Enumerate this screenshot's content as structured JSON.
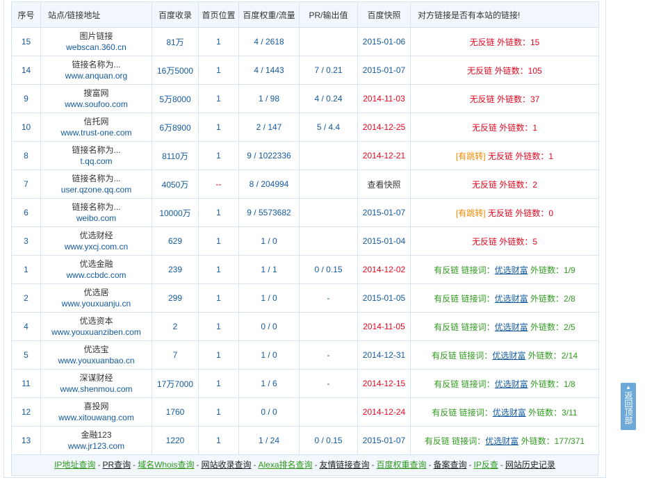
{
  "headers": {
    "seq": "序号",
    "site": "站点/链接地址",
    "baidu_index": "百度收录",
    "home_pos": "首页位置",
    "weight": "百度权重/流量",
    "pr": "PR/输出值",
    "snapshot": "百度快照",
    "status": "对方链接是否有本站的链接!"
  },
  "rows": [
    {
      "seq": "15",
      "name": "图片链接",
      "domain": "webscan.360.cn",
      "index": "81万",
      "pos": "1",
      "weight": "4 / 2618",
      "pr": "",
      "date": "2015-01-06",
      "date_color": "blue",
      "jump": "",
      "back": "无反链",
      "kw_label": "",
      "kw": "",
      "out_label": "外链数：",
      "out": "15",
      "ok": false
    },
    {
      "seq": "14",
      "name": "链接名称为...",
      "domain": "www.anquan.org",
      "index": "16万5000",
      "pos": "1",
      "weight": "4 / 1443",
      "pr": "7 / 0.21",
      "date": "2015-01-07",
      "date_color": "blue",
      "jump": "",
      "back": "无反链",
      "kw_label": "",
      "kw": "",
      "out_label": "外链数：",
      "out": "105",
      "ok": false
    },
    {
      "seq": "9",
      "name": "搜富网",
      "domain": "www.soufoo.com",
      "index": "5万8000",
      "pos": "1",
      "weight": "1 / 98",
      "pr": "4 / 0.24",
      "date": "2014-11-03",
      "date_color": "red",
      "jump": "",
      "back": "无反链",
      "kw_label": "",
      "kw": "",
      "out_label": "外链数：",
      "out": "37",
      "ok": false
    },
    {
      "seq": "10",
      "name": "信托网",
      "domain": "www.trust-one.com",
      "index": "6万8900",
      "pos": "1",
      "weight": "2 / 147",
      "pr": "5 / 4.4",
      "date": "2014-12-25",
      "date_color": "red",
      "jump": "",
      "back": "无反链",
      "kw_label": "",
      "kw": "",
      "out_label": "外链数：",
      "out": "1",
      "ok": false
    },
    {
      "seq": "8",
      "name": "链接名称为...",
      "domain": "t.qq.com",
      "index": "8110万",
      "pos": "1",
      "weight": "9 / 1022336",
      "pr": "",
      "date": "2014-12-21",
      "date_color": "red",
      "jump": "[有跳转]",
      "back": "无反链",
      "kw_label": "",
      "kw": "",
      "out_label": "外链数：",
      "out": "1",
      "ok": false
    },
    {
      "seq": "7",
      "name": "链接名称为...",
      "domain": "user.qzone.qq.com",
      "index": "4050万",
      "pos": "--",
      "weight": "8 / 204994",
      "pr": "",
      "date": "查看快照",
      "date_color": "dark",
      "jump": "",
      "back": "无反链",
      "kw_label": "",
      "kw": "",
      "out_label": "外链数：",
      "out": "2",
      "ok": false
    },
    {
      "seq": "6",
      "name": "链接名称为...",
      "domain": "weibo.com",
      "index": "10000万",
      "pos": "1",
      "weight": "9 / 5573682",
      "pr": "",
      "date": "2015-01-07",
      "date_color": "blue",
      "jump": "[有跳转]",
      "back": "无反链",
      "kw_label": "",
      "kw": "",
      "out_label": "外链数：",
      "out": "0",
      "ok": false
    },
    {
      "seq": "3",
      "name": "优选财经",
      "domain": "www.yxcj.com.cn",
      "index": "629",
      "pos": "1",
      "weight": "1 / 0",
      "pr": "",
      "date": "2015-01-04",
      "date_color": "blue",
      "jump": "",
      "back": "无反链",
      "kw_label": "",
      "kw": "",
      "out_label": "外链数：",
      "out": "5",
      "ok": false
    },
    {
      "seq": "1",
      "name": "优选金融",
      "domain": "www.ccbdc.com",
      "index": "239",
      "pos": "1",
      "weight": "1 / 1",
      "pr": "0 / 0.15",
      "date": "2014-12-02",
      "date_color": "red",
      "jump": "",
      "back": "有反链",
      "kw_label": "链接词：",
      "kw": "优选财富",
      "out_label": "外链数：",
      "out": "1/9",
      "ok": true
    },
    {
      "seq": "2",
      "name": "优选居",
      "domain": "www.youxuanju.cn",
      "index": "299",
      "pos": "1",
      "weight": "1 / 0",
      "pr": "-",
      "date": "2015-01-05",
      "date_color": "blue",
      "jump": "",
      "back": "有反链",
      "kw_label": "链接词：",
      "kw": "优选财富",
      "out_label": "外链数：",
      "out": "2/8",
      "ok": true
    },
    {
      "seq": "4",
      "name": "优选资本",
      "domain": "www.youxuanziben.com",
      "index": "2",
      "pos": "1",
      "weight": "0 / 0",
      "pr": "",
      "date": "2014-11-05",
      "date_color": "red",
      "jump": "",
      "back": "有反链",
      "kw_label": "链接词：",
      "kw": "优选财富",
      "out_label": "外链数：",
      "out": "2/5",
      "ok": true
    },
    {
      "seq": "5",
      "name": "优选宝",
      "domain": "www.youxuanbao.cn",
      "index": "7",
      "pos": "1",
      "weight": "1 / 0",
      "pr": "-",
      "date": "2014-12-31",
      "date_color": "blue",
      "jump": "",
      "back": "有反链",
      "kw_label": "链接词：",
      "kw": "优选财富",
      "out_label": "外链数：",
      "out": "2/14",
      "ok": true
    },
    {
      "seq": "11",
      "name": "深谋财经",
      "domain": "www.shenmou.com",
      "index": "17万7000",
      "pos": "1",
      "weight": "1 / 6",
      "pr": "-",
      "date": "2014-12-15",
      "date_color": "red",
      "jump": "",
      "back": "有反链",
      "kw_label": "链接词：",
      "kw": "优选财富",
      "out_label": "外链数：",
      "out": "1/8",
      "ok": true
    },
    {
      "seq": "12",
      "name": "喜投网",
      "domain": "www.xitouwang.com",
      "index": "1760",
      "pos": "1",
      "weight": "0 / 0",
      "pr": "",
      "date": "2014-12-24",
      "date_color": "red",
      "jump": "",
      "back": "有反链",
      "kw_label": "链接词：",
      "kw": "优选财富",
      "out_label": "外链数：",
      "out": "3/11",
      "ok": true
    },
    {
      "seq": "13",
      "name": "金融123",
      "domain": "www.jr123.com",
      "index": "1220",
      "pos": "1",
      "weight": "1 / 24",
      "pr": "0 / 0.15",
      "date": "2015-01-07",
      "date_color": "blue",
      "jump": "",
      "back": "有反链",
      "kw_label": "链接词：",
      "kw": "优选财富",
      "out_label": "外链数：",
      "out": "177/371",
      "ok": true
    }
  ],
  "footer_links": [
    {
      "label": "IP地址查询",
      "color": "green"
    },
    {
      "label": "PR查询",
      "color": "dark"
    },
    {
      "label": "域名Whois查询",
      "color": "green"
    },
    {
      "label": "网站收录查询",
      "color": "dark"
    },
    {
      "label": "Alexa排名查询",
      "color": "green"
    },
    {
      "label": "友情链接查询",
      "color": "dark"
    },
    {
      "label": "百度权重查询",
      "color": "green"
    },
    {
      "label": "备案查询",
      "color": "dark"
    },
    {
      "label": "IP反查",
      "color": "green"
    },
    {
      "label": "网站历史记录",
      "color": "dark"
    }
  ],
  "footer_separator": "-",
  "back_to_top": {
    "arrow": "▲",
    "label": "返回顶部"
  }
}
